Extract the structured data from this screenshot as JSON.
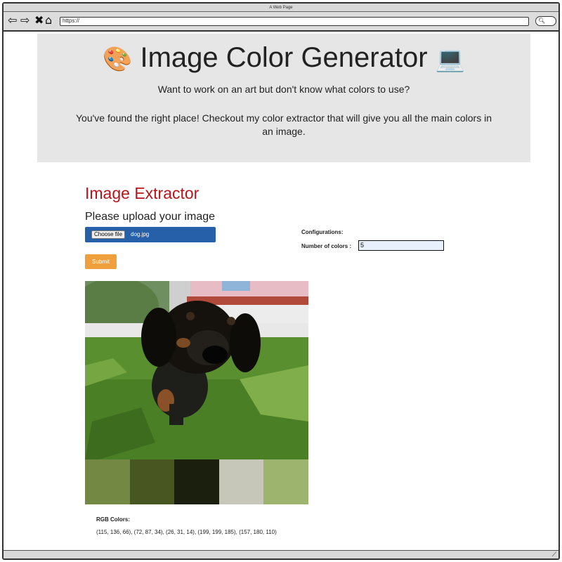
{
  "window": {
    "title": "A Web Page"
  },
  "browser": {
    "url": "https://",
    "icons": [
      "back-icon",
      "forward-icon",
      "stop-icon",
      "home-icon",
      "search-icon"
    ]
  },
  "hero": {
    "title": "Image Color Generator",
    "subtitle": "Want to work on an art but don't know what colors to use?",
    "description": "You've found the right place! Checkout my color extractor that will give you all the main colors in an image."
  },
  "extractor": {
    "title": "Image Extractor",
    "upload_label": "Please upload your image",
    "choose_file_label": "Choose file",
    "file_name": "dog.jpg",
    "submit_label": "Submit"
  },
  "config": {
    "title": "Configurations:",
    "num_colors_label": "Number of colors :",
    "num_colors_value": "5"
  },
  "results": {
    "rgb_title": "RGB Colors:",
    "rgb_values": "(115, 136, 66), (72, 87, 34), (26, 31, 14), (199, 199, 185), (157, 180, 110)",
    "swatches": [
      "#738842",
      "#485722",
      "#1a1f0e",
      "#c7c7b9",
      "#9db46e"
    ]
  },
  "colors": {
    "accent_red": "#b8141b",
    "file_input_blue": "#2560a8",
    "submit_orange": "#ef9f3c",
    "hero_bg": "#e6e6e6"
  }
}
